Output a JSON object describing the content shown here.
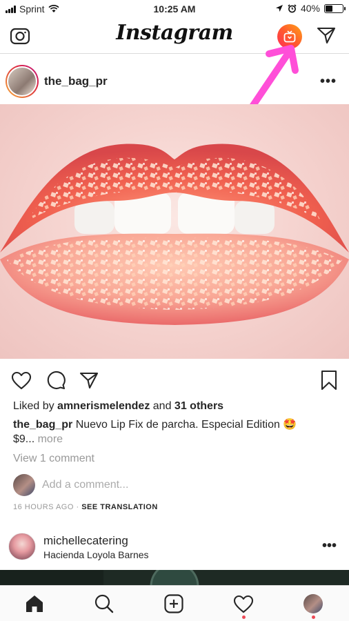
{
  "status_bar": {
    "carrier": "Sprint",
    "time": "10:25 AM",
    "battery": "40%",
    "battery_level": 0.4,
    "icons": [
      "signal-icon",
      "wifi-icon",
      "location-icon",
      "alarm-icon",
      "battery-icon"
    ]
  },
  "header": {
    "logo": "Instagram",
    "icons": [
      "camera-icon",
      "igtv-icon",
      "direct-message-icon"
    ],
    "accent": "#ff5a2e",
    "annotation_color": "#ff4fd8"
  },
  "post": {
    "username": "the_bag_pr",
    "more": "•••",
    "liked_prefix": "Liked by ",
    "liked_user": "amnerismelendez",
    "liked_mid": " and ",
    "liked_others": "31 others",
    "caption_user": "the_bag_pr",
    "caption_text": " Nuevo Lip Fix de parcha. Especial Edition 🤩 $9...",
    "caption_more": "more",
    "view_comments": "View 1 comment",
    "add_comment_placeholder": "Add a comment...",
    "time_ago": "16 HOURS AGO",
    "separator": " · ",
    "see_translation": "SEE TRANSLATION"
  },
  "post2": {
    "username": "michellecatering",
    "location": "Hacienda Loyola Barnes",
    "more": "•••"
  },
  "nav": {
    "items": [
      "home-icon",
      "search-icon",
      "new-post-icon",
      "activity-icon",
      "profile-icon"
    ],
    "notification_color": "#ed4956"
  }
}
